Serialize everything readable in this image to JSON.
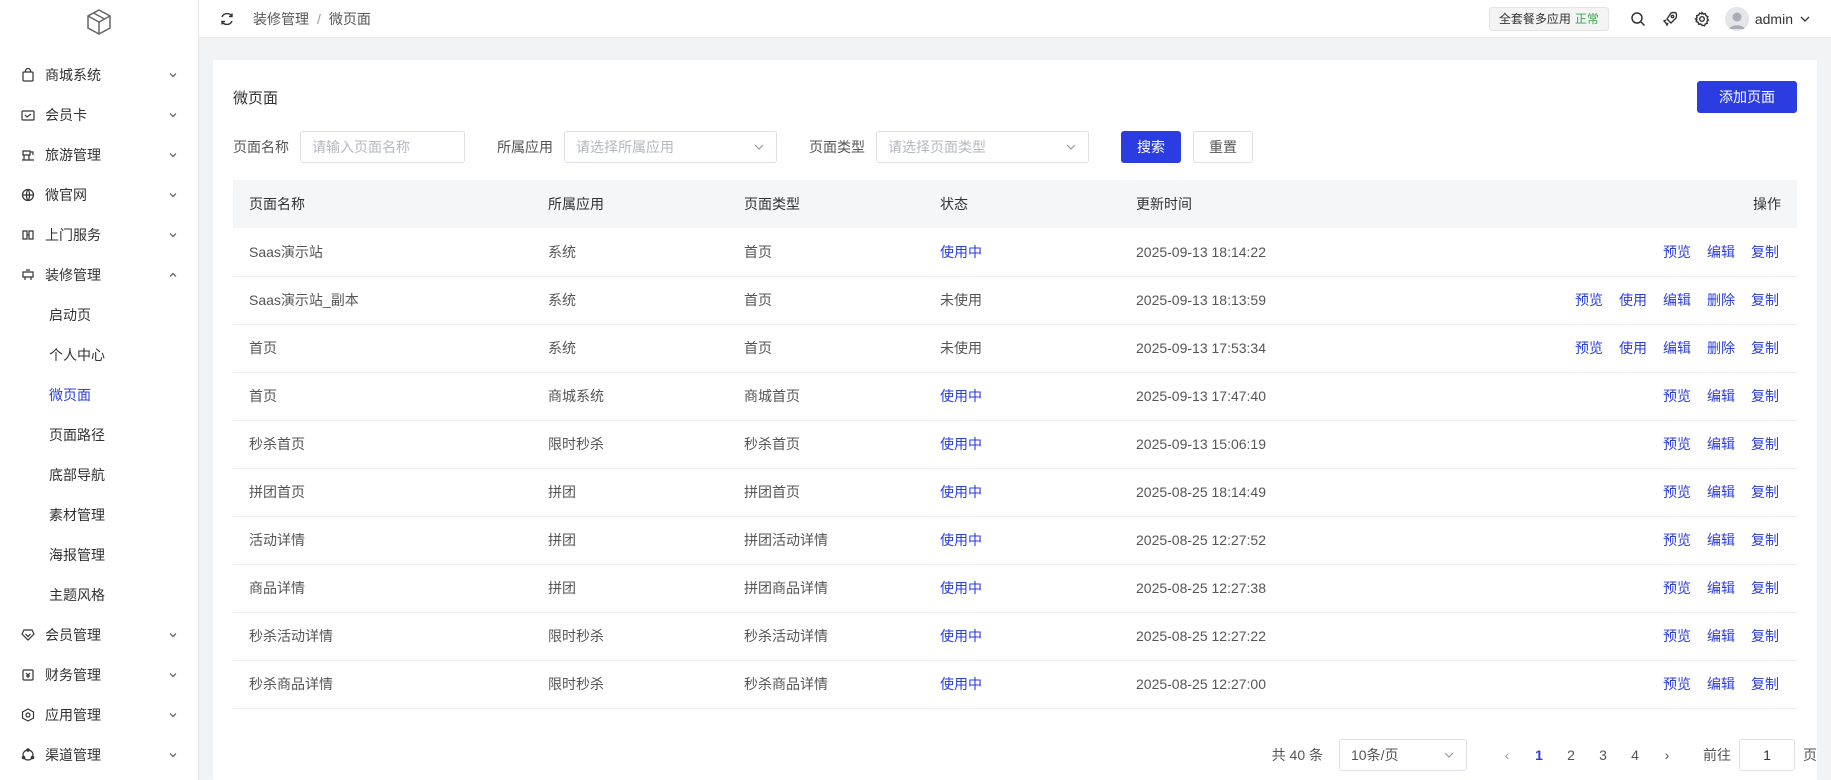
{
  "sidebar": {
    "logo_icon": "cube-logo-icon",
    "items": [
      {
        "label": "商城系统",
        "icon": "shop-bag-icon",
        "expanded": false
      },
      {
        "label": "会员卡",
        "icon": "member-card-icon",
        "expanded": false
      },
      {
        "label": "旅游管理",
        "icon": "travel-icon",
        "expanded": false
      },
      {
        "label": "微官网",
        "icon": "globe-icon",
        "expanded": false
      },
      {
        "label": "上门服务",
        "icon": "service-icon",
        "expanded": false
      },
      {
        "label": "装修管理",
        "icon": "decoration-icon",
        "expanded": true
      },
      {
        "label": "会员管理",
        "icon": "member-icon",
        "expanded": false
      },
      {
        "label": "财务管理",
        "icon": "finance-icon",
        "expanded": false
      },
      {
        "label": "应用管理",
        "icon": "app-icon",
        "expanded": false
      },
      {
        "label": "渠道管理",
        "icon": "channel-icon",
        "expanded": false
      }
    ],
    "sub_items": [
      "启动页",
      "个人中心",
      "微页面",
      "页面路径",
      "底部导航",
      "素材管理",
      "海报管理",
      "主题风格"
    ],
    "active_sub": "微页面"
  },
  "header": {
    "breadcrumb": [
      "装修管理",
      "微页面"
    ],
    "plan_label": "全套餐多应用",
    "plan_status": "正常",
    "user": "admin"
  },
  "page": {
    "title": "微页面",
    "add_button": "添加页面"
  },
  "filters": {
    "name_label": "页面名称",
    "name_placeholder": "请输入页面名称",
    "app_label": "所属应用",
    "app_placeholder": "请选择所属应用",
    "type_label": "页面类型",
    "type_placeholder": "请选择页面类型",
    "search": "搜索",
    "reset": "重置"
  },
  "table": {
    "columns": [
      "页面名称",
      "所属应用",
      "页面类型",
      "状态",
      "更新时间",
      "操作"
    ],
    "rows": [
      {
        "name": "Saas演示站",
        "app": "系统",
        "type": "首页",
        "status": "使用中",
        "active": true,
        "time": "2025-09-13 18:14:22",
        "ops": [
          "预览",
          "编辑",
          "复制"
        ]
      },
      {
        "name": "Saas演示站_副本",
        "app": "系统",
        "type": "首页",
        "status": "未使用",
        "active": false,
        "time": "2025-09-13 18:13:59",
        "ops": [
          "预览",
          "使用",
          "编辑",
          "删除",
          "复制"
        ]
      },
      {
        "name": "首页",
        "app": "系统",
        "type": "首页",
        "status": "未使用",
        "active": false,
        "time": "2025-09-13 17:53:34",
        "ops": [
          "预览",
          "使用",
          "编辑",
          "删除",
          "复制"
        ]
      },
      {
        "name": "首页",
        "app": "商城系统",
        "type": "商城首页",
        "status": "使用中",
        "active": true,
        "time": "2025-09-13 17:47:40",
        "ops": [
          "预览",
          "编辑",
          "复制"
        ]
      },
      {
        "name": "秒杀首页",
        "app": "限时秒杀",
        "type": "秒杀首页",
        "status": "使用中",
        "active": true,
        "time": "2025-09-13 15:06:19",
        "ops": [
          "预览",
          "编辑",
          "复制"
        ]
      },
      {
        "name": "拼团首页",
        "app": "拼团",
        "type": "拼团首页",
        "status": "使用中",
        "active": true,
        "time": "2025-08-25 18:14:49",
        "ops": [
          "预览",
          "编辑",
          "复制"
        ]
      },
      {
        "name": "活动详情",
        "app": "拼团",
        "type": "拼团活动详情",
        "status": "使用中",
        "active": true,
        "time": "2025-08-25 12:27:52",
        "ops": [
          "预览",
          "编辑",
          "复制"
        ]
      },
      {
        "name": "商品详情",
        "app": "拼团",
        "type": "拼团商品详情",
        "status": "使用中",
        "active": true,
        "time": "2025-08-25 12:27:38",
        "ops": [
          "预览",
          "编辑",
          "复制"
        ]
      },
      {
        "name": "秒杀活动详情",
        "app": "限时秒杀",
        "type": "秒杀活动详情",
        "status": "使用中",
        "active": true,
        "time": "2025-08-25 12:27:22",
        "ops": [
          "预览",
          "编辑",
          "复制"
        ]
      },
      {
        "name": "秒杀商品详情",
        "app": "限时秒杀",
        "type": "秒杀商品详情",
        "status": "使用中",
        "active": true,
        "time": "2025-08-25 12:27:00",
        "ops": [
          "预览",
          "编辑",
          "复制"
        ]
      }
    ]
  },
  "pagination": {
    "total": "共 40 条",
    "page_size": "10条/页",
    "pages": [
      "1",
      "2",
      "3",
      "4"
    ],
    "current": "1",
    "goto_label": "前往",
    "goto_value": "1",
    "unit": "页"
  },
  "colors": {
    "accent": "#2b3de0",
    "ok": "#3aa54a"
  }
}
